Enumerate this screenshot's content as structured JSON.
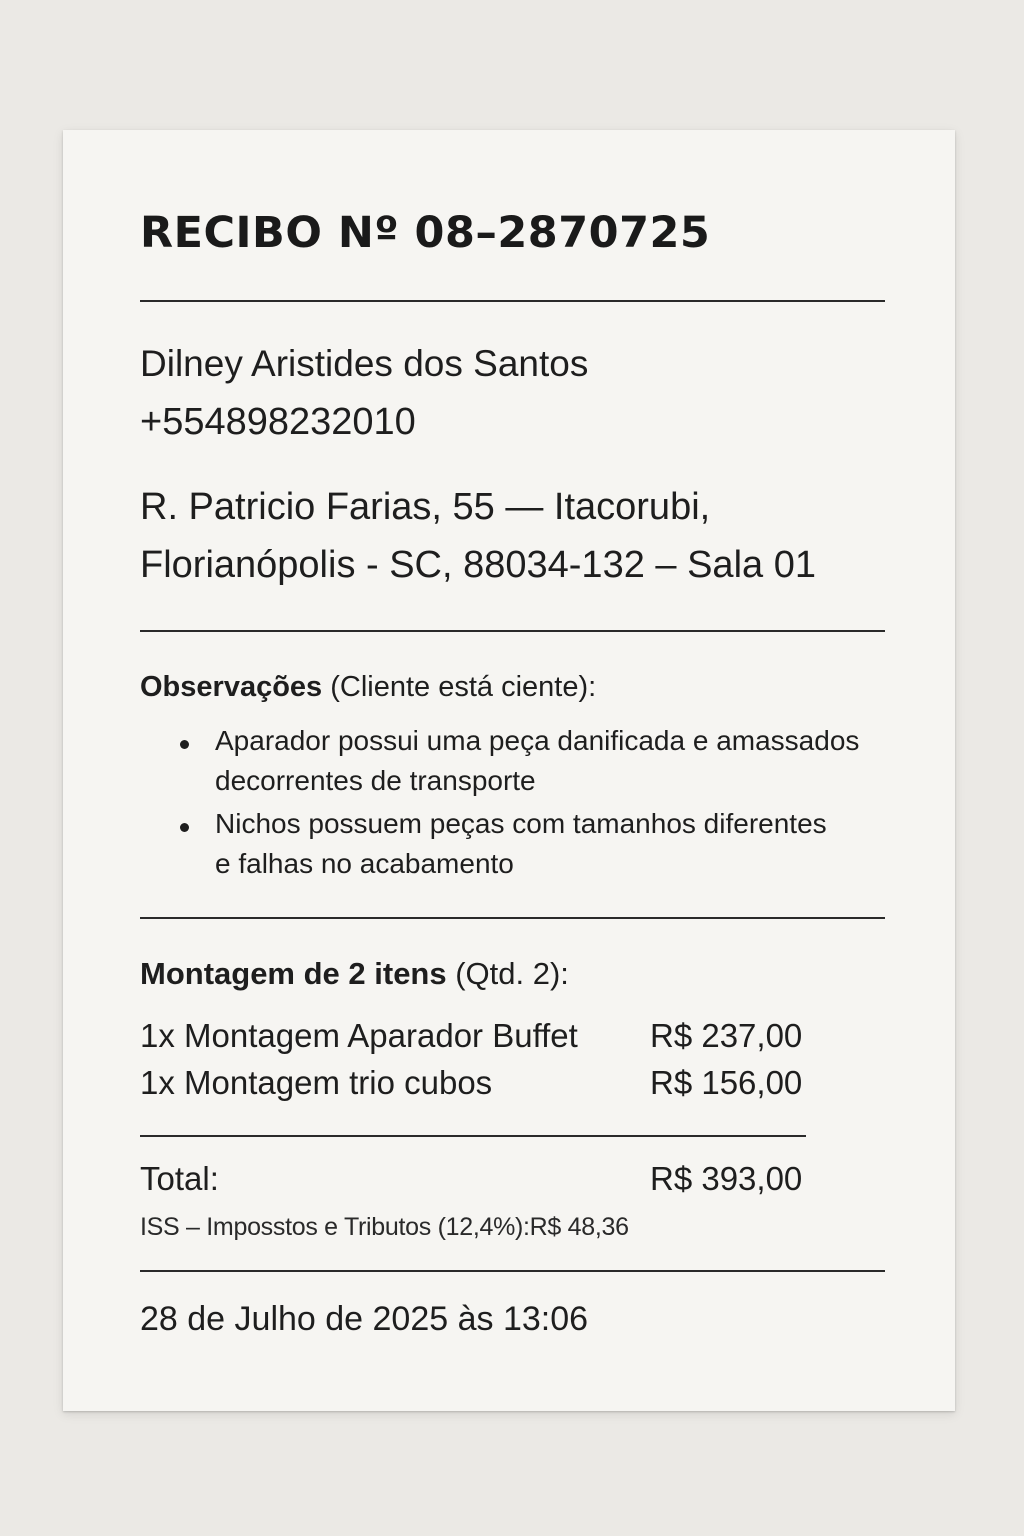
{
  "receipt": {
    "title": "RECIBO Nº 08–2870725",
    "client_name": "Dilney Aristides dos Santos",
    "phone": "+554898232010",
    "address_line1": "R. Patricio Farias, 55 — Itacorubi,",
    "address_line2": "Florianópolis - SC, 88034-132 – Sala 01",
    "observations": {
      "heading_bold": "Observações",
      "heading_rest": " (Cliente está ciente):",
      "items": [
        {
          "line1": "Aparador possui uma peça danificada e amassados",
          "line2": "decorrentes de transporte"
        },
        {
          "line1": "Nichos possuem peças com tamanhos diferentes",
          "line2": "e falhas no acabamento"
        }
      ]
    },
    "service": {
      "heading_bold": "Montagem de 2 itens",
      "heading_rest": " (Qtd. 2):",
      "lines": [
        {
          "description": "1x Montagem Aparador Buffet",
          "price": "R$ 237,00"
        },
        {
          "description": "1x Montagem trio cubos",
          "price": "R$ 156,00"
        }
      ]
    },
    "total_label": "Total:",
    "total_value": "R$ 393,00",
    "tax_line": "ISS – Imposstos e Tributos (12,4%):R$ 48,36",
    "date": "28 de Julho de 2025 às 13:06"
  }
}
